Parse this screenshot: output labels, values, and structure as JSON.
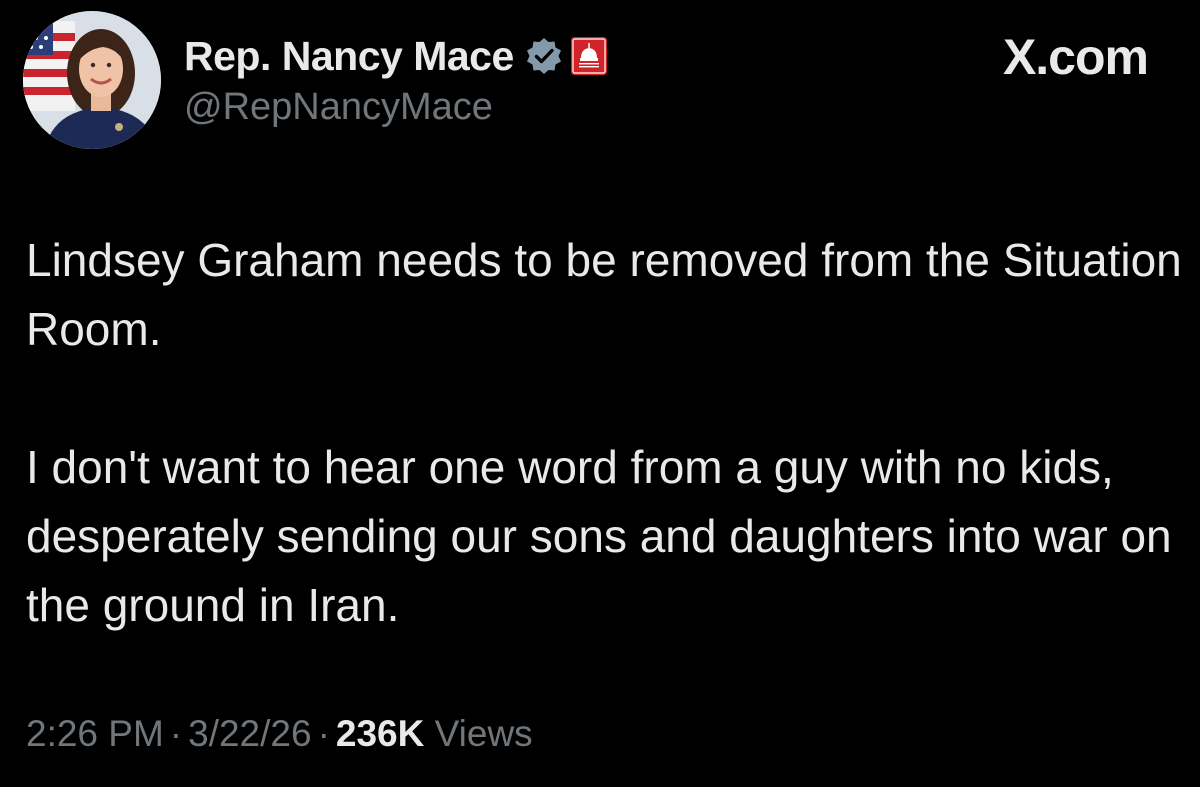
{
  "author": {
    "display_name": "Rep. Nancy Mace",
    "handle": "@RepNancyMace",
    "verified_icon": "verified-badge-icon",
    "affiliation_icon": "house-gop-badge-icon"
  },
  "site": {
    "label": "X.com"
  },
  "tweet": {
    "paragraphs": [
      "Lindsey Graham needs to be removed from the Situation Room.",
      "I don't want to hear one word from a guy with no kids, desperately sending our sons and daughters into war on the ground in Iran."
    ]
  },
  "meta": {
    "time": "2:26 PM",
    "separator": "·",
    "date": "3/22/26",
    "views_count": "236K",
    "views_label": "Views"
  },
  "colors": {
    "background": "#000000",
    "primary_text": "#e7e9ea",
    "secondary_text": "#71767b",
    "verified": "#829aab",
    "affiliation_red": "#d0232a"
  }
}
